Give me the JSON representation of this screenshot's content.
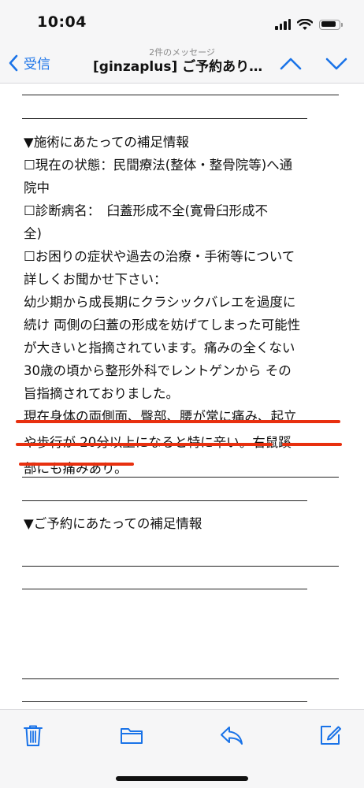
{
  "status_bar": {
    "time": "10:04",
    "signal_bars": 4,
    "battery_level": 0.9
  },
  "nav": {
    "back_label": "受信",
    "message_count": "2件のメッセージ",
    "title": "[ginzaplus] ご予約あり…",
    "back_icon": "chevron-left-icon",
    "up_icon": "chevron-up-icon",
    "down_icon": "chevron-down-icon",
    "accent_color": "#1a73e8"
  },
  "email": {
    "treatment_heading": "▼施術にあたっての補足情報",
    "status_line_1": "☐現在の状態：民間療法(整体・整骨院等)へ通",
    "status_line_2": "院中",
    "diagnosis_line_1": "☐診断病名：　臼蓋形成不全(寛骨臼形成不",
    "diagnosis_line_2": "全)",
    "concerns_line_1": "☐お困りの症状や過去の治療・手術等について",
    "concerns_line_2": "詳しくお聞かせ下さい：",
    "history_1": "幼少期から成長期にクラシックバレエを過度に",
    "history_2": "続け 両側の臼蓋の形成を妨げてしまった可能性",
    "history_3": "が大きいと指摘されています。痛みの全くない",
    "history_4": "30歳の頃から整形外科でレントゲンから その",
    "history_5": "旨指摘されておりました。",
    "current_1": "現在身体の両側面、臀部、腰が常に痛み、起立",
    "current_2": "や歩行が 20分以上になると特に辛い。右鼠蹊",
    "current_3": "部にも痛みあり。",
    "reservation_heading": "▼ご予約にあたっての補足情報",
    "highlight_color": "#e8300f"
  },
  "toolbar": {
    "trash_icon": "trash-icon",
    "folder_icon": "folder-icon",
    "reply_icon": "reply-icon",
    "compose_icon": "compose-icon"
  }
}
